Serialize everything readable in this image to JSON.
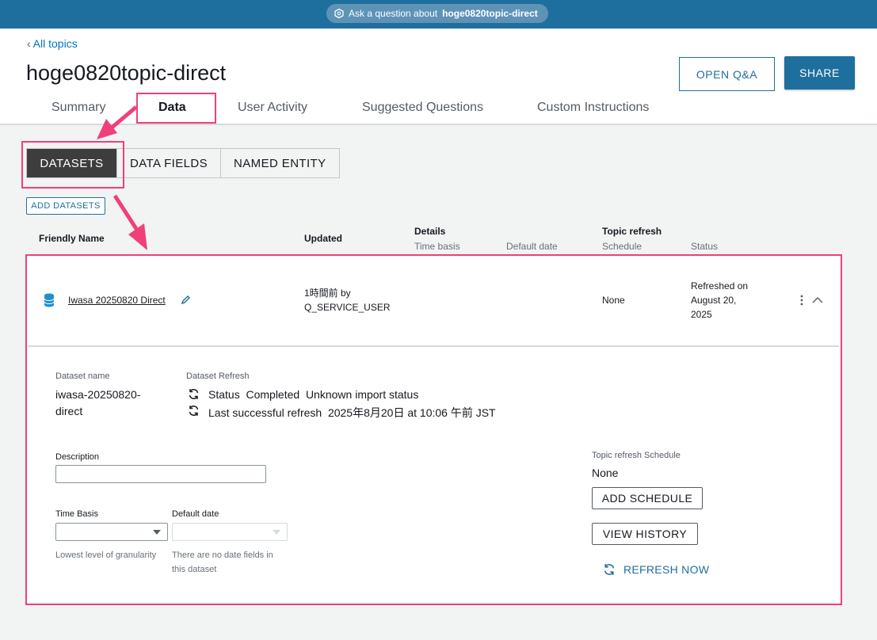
{
  "topbar": {
    "ask_prefix": "Ask a question about",
    "ask_topic": "hoge0820topic-direct",
    "icon": "q-icon"
  },
  "header": {
    "back_link": "All topics",
    "title": "hoge0820topic-direct",
    "open_qa": "OPEN Q&A",
    "share": "SHARE"
  },
  "tabs": [
    {
      "label": "Summary",
      "active": false
    },
    {
      "label": "Data",
      "active": true
    },
    {
      "label": "User Activity",
      "active": false
    },
    {
      "label": "Suggested Questions",
      "active": false
    },
    {
      "label": "Custom Instructions",
      "active": false
    }
  ],
  "segments": [
    {
      "label": "DATASETS",
      "active": true
    },
    {
      "label": "DATA FIELDS",
      "active": false
    },
    {
      "label": "NAMED ENTITY",
      "active": false
    }
  ],
  "add_datasets": "ADD DATASETS",
  "table": {
    "headers": {
      "friendly_name": "Friendly Name",
      "updated": "Updated",
      "details": "Details",
      "time_basis": "Time basis",
      "default_date": "Default date",
      "topic_refresh": "Topic refresh",
      "schedule": "Schedule",
      "status": "Status"
    },
    "row": {
      "name": "Iwasa 20250820 Direct",
      "updated_line1": "1時間前 by",
      "updated_line2": "Q_SERVICE_USER",
      "schedule": "None",
      "status_line1": "Refreshed on",
      "status_line2": "August 20,",
      "status_line3": "2025"
    }
  },
  "detail": {
    "dataset_name_label": "Dataset name",
    "dataset_name_line1": "iwasa-20250820-",
    "dataset_name_line2": "direct",
    "refresh_label": "Dataset Refresh",
    "status_line": "Status  Completed  Unknown import status",
    "last_refresh_line": "Last successful refresh  2025年8月20日 at 10:06 午前 JST",
    "description_label": "Description",
    "description_value": "",
    "time_basis_label": "Time Basis",
    "time_basis_value": "",
    "default_date_label": "Default date",
    "default_date_value": "",
    "time_basis_hint": "Lowest level of granularity",
    "default_date_hint_line1": "There are no date fields in",
    "default_date_hint_line2": "this dataset",
    "topic_refresh_schedule_label": "Topic refresh Schedule",
    "topic_refresh_schedule_value": "None",
    "add_schedule": "ADD SCHEDULE",
    "view_history": "VIEW HISTORY",
    "refresh_now": "REFRESH NOW"
  },
  "colors": {
    "brand": "#1f6f9e",
    "highlight": "#f0407a",
    "segment_active": "#3d3d3d"
  }
}
